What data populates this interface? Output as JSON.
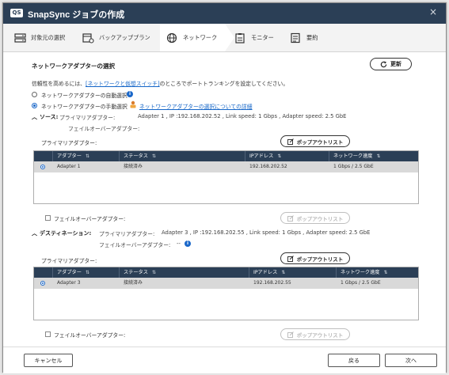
{
  "window": {
    "logo_text": "QS",
    "title": "SnapSync ジョブの作成",
    "close_symbol": "×"
  },
  "steps": [
    {
      "label": "対象元の選択",
      "icon": "storage-icon"
    },
    {
      "label": "バックアッププラン",
      "icon": "calendar-gear-icon"
    },
    {
      "label": "ネットワーク",
      "icon": "globe-icon",
      "active": true
    },
    {
      "label": "モニター",
      "icon": "clipboard-icon"
    },
    {
      "label": "要約",
      "icon": "list-icon"
    }
  ],
  "network": {
    "section_title": "ネットワークアダプターの選択",
    "refresh_label": "更新",
    "hint_before": "信頼性を高めるには、",
    "hint_link": "[ネットワークと仮想スイッチ]",
    "hint_after": "のところでポートトランキングを設定してください。",
    "auto_select_label": "ネットワークアダプターの自動選択",
    "manual_select_label": "ネットワークアダプターの手動選択",
    "guide_link": "ネットワークアダプターの選択についての詳細"
  },
  "source": {
    "heading": "ソース:",
    "primary_label": "プライマリアダプター:",
    "primary_value": "Adapter 1 , IP :192.168.202.52 , Link speed: 1 Gbps , Adapter speed: 2.5 GbE",
    "failover_label": "フェイルオーバーアダプター:",
    "failover_value": "",
    "table_title": "プライマリアダプター:",
    "popout_label": "ポップアウトリスト",
    "columns": [
      "アダプター",
      "ステータス",
      "IPアドレス",
      "ネットワーク速度"
    ],
    "rows": [
      {
        "adapter": "Adapter 1",
        "status": "接続済み",
        "ip": "192.168.202.52",
        "speed": "1 Gbps / 2.5 GbE"
      }
    ],
    "failover_checkbox_label": "フェイルオーバーアダプター:",
    "failover_popout_label": "ポップアウトリスト"
  },
  "destination": {
    "heading": "デスティネーション:",
    "primary_label": "プライマリアダプター:",
    "primary_value": "Adapter 3 , IP :192.168.202.55 , Link speed: 1 Gbps , Adapter speed: 2.5 GbE",
    "failover_label": "フェイルオーバーアダプター:",
    "failover_value": "--",
    "table_title": "プライマリアダプター:",
    "popout_label": "ポップアウトリスト",
    "columns": [
      "アダプター",
      "ステータス",
      "IPアドレス",
      "ネットワーク速度"
    ],
    "rows": [
      {
        "adapter": "Adapter 3",
        "status": "接続済み",
        "ip": "192.168.202.55",
        "speed": "1 Gbps / 2.5 GbE"
      }
    ],
    "failover_checkbox_label": "フェイルオーバーアダプター:",
    "failover_popout_label": "ポップアウトリスト"
  },
  "footer": {
    "cancel_label": "キャンセル",
    "back_label": "戻る",
    "next_label": "次へ"
  },
  "colors": {
    "titlebar": "#2b3f56",
    "accent": "#1a67c9",
    "row_selected": "#d9d9d9"
  }
}
